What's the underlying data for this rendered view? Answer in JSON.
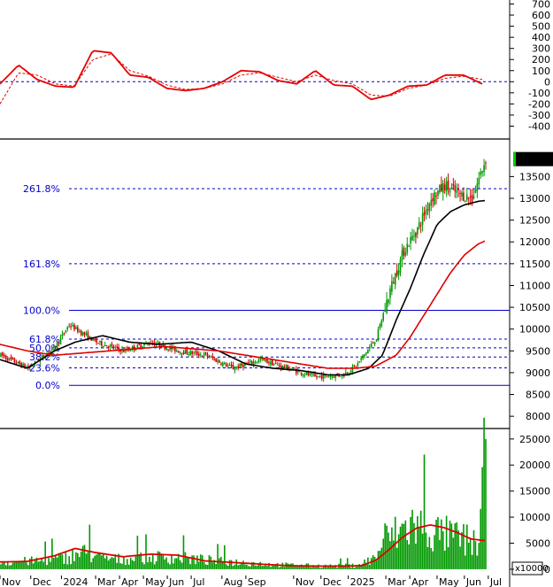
{
  "chart_data": [
    {
      "type": "line",
      "panel": "oscillator",
      "y_ticks": [
        700,
        600,
        500,
        400,
        300,
        200,
        100,
        0,
        -100,
        -200,
        -300,
        -400
      ],
      "ylim": [
        -460,
        720
      ],
      "zero_line": 0,
      "series": [
        {
          "color": "#e60000",
          "style": "solid",
          "x": [
            0,
            4,
            8,
            12,
            16,
            20,
            24,
            28,
            32,
            36,
            40,
            44,
            48,
            52,
            56,
            60,
            64,
            68,
            72,
            76,
            80,
            84,
            88,
            92,
            96,
            100,
            104
          ],
          "values": [
            -20,
            150,
            20,
            -40,
            -50,
            280,
            260,
            60,
            40,
            -60,
            -80,
            -60,
            0,
            100,
            90,
            10,
            -20,
            100,
            -30,
            -40,
            -160,
            -120,
            -40,
            -30,
            60,
            60,
            -20
          ]
        },
        {
          "color": "#e60000",
          "style": "dashed",
          "x": [
            0,
            4,
            8,
            12,
            16,
            20,
            24,
            28,
            32,
            36,
            40,
            44,
            48,
            52,
            56,
            60,
            64,
            68,
            72,
            76,
            80,
            84,
            88,
            92,
            96,
            100,
            104
          ],
          "values": [
            -200,
            80,
            60,
            -20,
            -40,
            200,
            250,
            100,
            50,
            -30,
            -70,
            -60,
            -20,
            60,
            80,
            40,
            0,
            60,
            10,
            -20,
            -120,
            -130,
            -60,
            -30,
            30,
            50,
            20
          ]
        }
      ]
    },
    {
      "type": "candlestick",
      "panel": "price",
      "last_price_label": "13900.00",
      "y_ticks": [
        13500,
        13000,
        12500,
        12000,
        11500,
        11000,
        10500,
        10000,
        9500,
        9000,
        8500,
        8000
      ],
      "ylim": [
        7800,
        14300
      ],
      "fibonacci": [
        {
          "label": "261.8%",
          "value": 13220
        },
        {
          "label": "161.8%",
          "value": 11500
        },
        {
          "label": "100.0%",
          "value": 10430
        },
        {
          "label": "61.8%",
          "value": 9770
        },
        {
          "label": "50.0%",
          "value": 9570
        },
        {
          "label": "38.2%",
          "value": 9360
        },
        {
          "label": "23.6%",
          "value": 9110
        },
        {
          "label": "0.0%",
          "value": 8710
        }
      ],
      "x_labels": [
        "Nov",
        "Dec",
        "2024",
        "Mar",
        "Apr",
        "May",
        "Jun",
        "Jul",
        "Aug",
        "Sep",
        "Nov",
        "Dec",
        "2025",
        "Mar",
        "Apr",
        "May",
        "Jun",
        "Jul"
      ],
      "x_positions": [
        0,
        4.5,
        9,
        14,
        17.5,
        21,
        24.5,
        28,
        32.5,
        36,
        43,
        47,
        51,
        56.5,
        60,
        64,
        68,
        71.5
      ],
      "price_anchor_x": [
        0,
        4,
        8,
        10,
        14,
        18,
        22,
        26,
        30,
        34,
        38,
        42,
        46,
        50,
        52,
        55,
        57,
        59,
        61,
        63,
        65,
        67,
        69,
        71
      ],
      "price_anchor_y": [
        9400,
        9100,
        9600,
        10100,
        9700,
        9500,
        9700,
        9500,
        9400,
        9100,
        9300,
        9100,
        8900,
        8950,
        9150,
        9800,
        10900,
        11800,
        12300,
        13000,
        13300,
        13100,
        13000,
        13900
      ],
      "series": [
        {
          "name": "",
          "color": "#000000",
          "x": [
            0,
            4,
            8,
            11,
            15,
            19,
            23,
            28,
            32,
            36,
            40,
            44,
            48,
            51,
            54,
            56,
            58,
            60,
            62,
            64,
            66,
            68,
            70,
            71
          ],
          "values": [
            9300,
            9100,
            9500,
            9700,
            9850,
            9700,
            9650,
            9700,
            9500,
            9200,
            9100,
            9050,
            8950,
            8950,
            9100,
            9400,
            10200,
            10900,
            11700,
            12400,
            12700,
            12850,
            12930,
            12950
          ]
        },
        {
          "name": "",
          "color": "#dd0000",
          "x": [
            0,
            4,
            8,
            12,
            16,
            20,
            24,
            28,
            32,
            36,
            40,
            44,
            48,
            52,
            55,
            58,
            60,
            62,
            64,
            66,
            68,
            70,
            71
          ],
          "values": [
            9650,
            9500,
            9400,
            9450,
            9500,
            9550,
            9600,
            9550,
            9500,
            9400,
            9300,
            9200,
            9100,
            9100,
            9150,
            9400,
            9800,
            10300,
            10800,
            11300,
            11700,
            11950,
            12020
          ]
        }
      ]
    },
    {
      "type": "bar",
      "panel": "volume",
      "unit_label": "x10000",
      "y_ticks": [
        25000,
        20000,
        15000,
        10000,
        5000,
        0
      ],
      "ylim": [
        -1200,
        26500
      ],
      "vol_anchor_x": [
        0,
        6,
        10,
        12,
        14,
        17,
        20,
        24,
        28,
        32,
        36,
        40,
        44,
        48,
        52,
        55,
        56,
        58,
        60,
        62,
        64,
        66,
        68,
        70,
        71
      ],
      "vol_anchor_y": [
        1500,
        1800,
        2600,
        3600,
        2500,
        2100,
        2300,
        2600,
        2200,
        1700,
        1400,
        1000,
        800,
        700,
        800,
        2500,
        6500,
        7500,
        9500,
        8500,
        7500,
        7000,
        6200,
        5500,
        25000
      ],
      "series": [
        {
          "name": "",
          "color": "#dd0000",
          "x": [
            0,
            4,
            8,
            11,
            14,
            18,
            22,
            26,
            30,
            34,
            38,
            42,
            46,
            50,
            53,
            55,
            57,
            59,
            61,
            63,
            65,
            67,
            69,
            71
          ],
          "values": [
            1400,
            1500,
            2600,
            4000,
            3200,
            2400,
            2900,
            2700,
            1600,
            1300,
            1000,
            700,
            600,
            600,
            700,
            1700,
            3800,
            6200,
            7900,
            8500,
            8000,
            7000,
            5800,
            5500
          ]
        }
      ]
    }
  ]
}
